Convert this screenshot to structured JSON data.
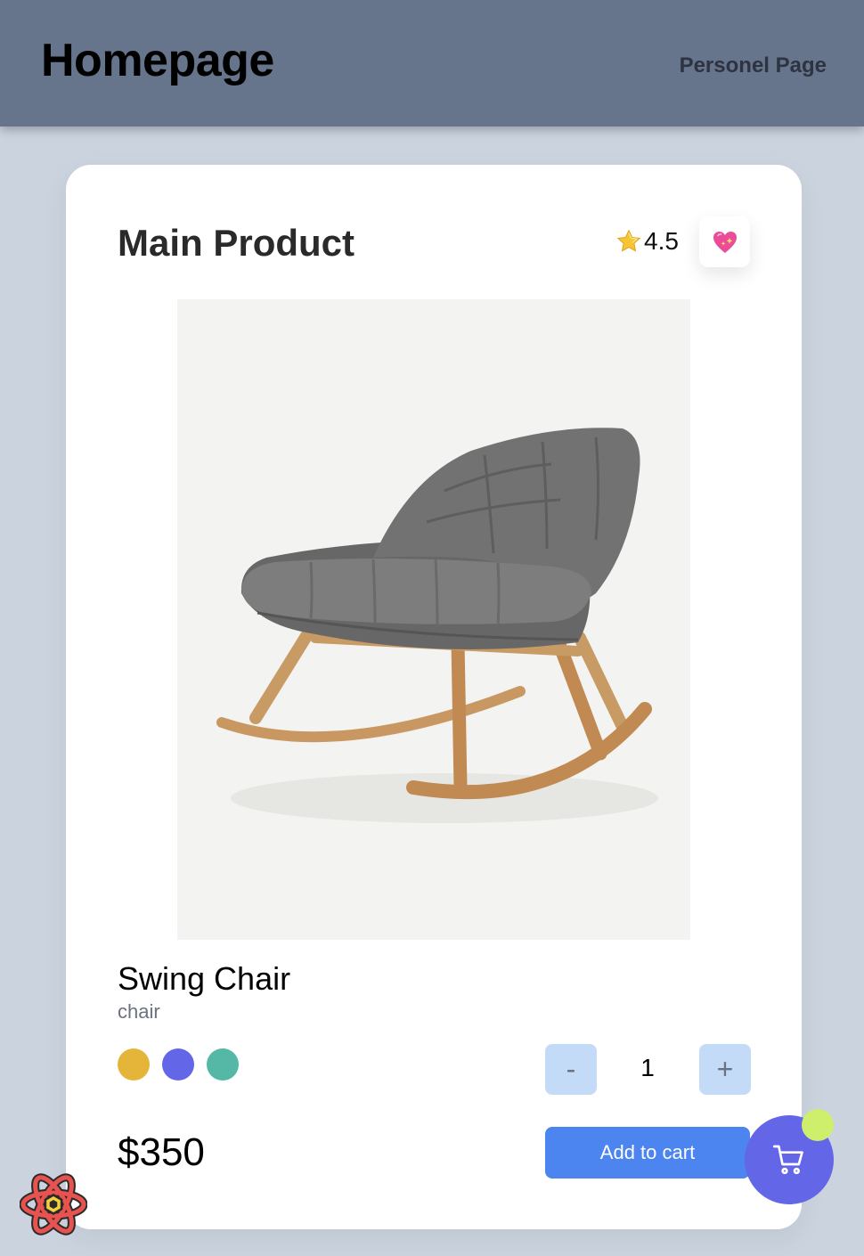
{
  "header": {
    "title": "Homepage",
    "nav_link": "Personel Page",
    "background": "#67758c"
  },
  "product": {
    "section_title": "Main Product",
    "rating": "4.5",
    "rating_icon": "star-icon",
    "favorite_icon": "sparkling-heart-icon",
    "image_icon": "rocking-chair-image",
    "name": "Swing Chair",
    "category": "chair",
    "colors": [
      "#e5b53a",
      "#6466e8",
      "#55b8a7"
    ],
    "quantity": {
      "decrement_label": "-",
      "value": "1",
      "increment_label": "+"
    },
    "price": "$350",
    "add_to_cart_label": "Add to cart"
  },
  "cart": {
    "icon": "shopping-cart-icon",
    "badge_color": "#cdef6b",
    "button_color": "#6466e8"
  },
  "accent": "#4c85ef"
}
